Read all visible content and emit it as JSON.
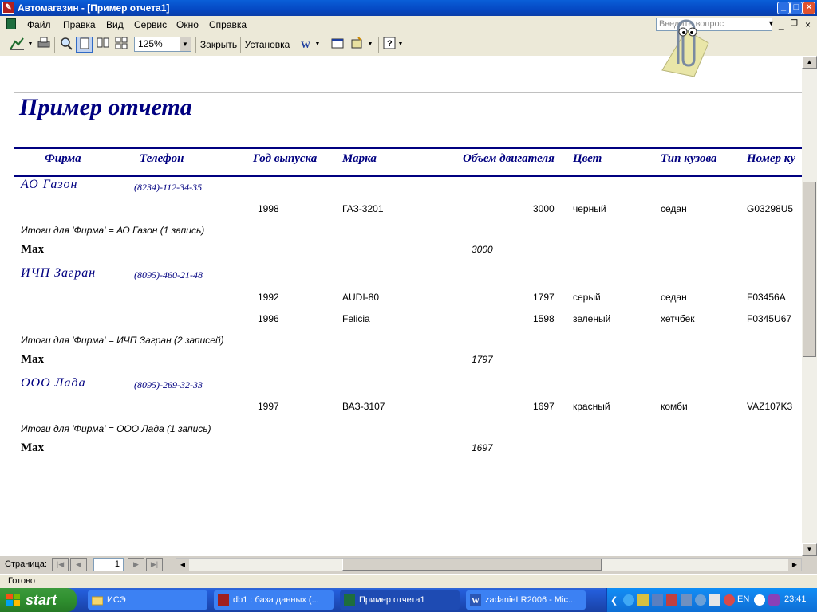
{
  "window": {
    "title": "Автомагазин - [Пример отчета1]"
  },
  "menu": {
    "items": [
      "Файл",
      "Правка",
      "Вид",
      "Сервис",
      "Окно",
      "Справка"
    ],
    "ask_placeholder": "Введите вопрос"
  },
  "toolbar": {
    "zoom": "125%",
    "close_label": "Закрыть",
    "setup_label": "Установка"
  },
  "report": {
    "title": "Пример отчета",
    "columns": [
      "Фирма",
      "Телефон",
      "Год выпуска",
      "Марка",
      "Объем двигателя",
      "Цвет",
      "Тип кузова",
      "Номер ку"
    ],
    "max_label": "Max",
    "groups": [
      {
        "firm": "АО Газон",
        "phone": "(8234)-112-34-35",
        "rows": [
          {
            "year": "1998",
            "model": "ГАЗ-3201",
            "engine": "3000",
            "color": "черный",
            "body": "седан",
            "number": "G03298U5"
          }
        ],
        "total": "Итоги для 'Фирма' =  АО Газон (1 запись)",
        "max": "3000"
      },
      {
        "firm": "ИЧП Загран",
        "phone": "(8095)-460-21-48",
        "rows": [
          {
            "year": "1992",
            "model": "AUDI-80",
            "engine": "1797",
            "color": "серый",
            "body": "седан",
            "number": "F03456A"
          },
          {
            "year": "1996",
            "model": "Felicia",
            "engine": "1598",
            "color": "зеленый",
            "body": "хетчбек",
            "number": "F0345U67"
          }
        ],
        "total": "Итоги для 'Фирма' =  ИЧП Загран (2 записей)",
        "max": "1797"
      },
      {
        "firm": "ООО Лада",
        "phone": "(8095)-269-32-33",
        "rows": [
          {
            "year": "1997",
            "model": "ВАЗ-3107",
            "engine": "1697",
            "color": "красный",
            "body": "комби",
            "number": "VAZ107K3"
          }
        ],
        "total": "Итоги для 'Фирма' =  ООО Лада (1 запись)",
        "max": "1697"
      }
    ]
  },
  "navigation": {
    "page_label": "Страница:",
    "page_value": "1"
  },
  "status": {
    "text": "Готово"
  },
  "taskbar": {
    "start_label": "start",
    "tasks": [
      "ИСЭ",
      "db1 : база данных (...",
      "Пример отчета1",
      "zadanieLR2006 - Mic..."
    ],
    "lang": "EN",
    "clock": "23:41"
  },
  "colors": {
    "report_navy": "#000080",
    "titlebar_blue": "#0548c3",
    "taskbar_blue": "#245edb",
    "start_green": "#2f8f2f"
  }
}
